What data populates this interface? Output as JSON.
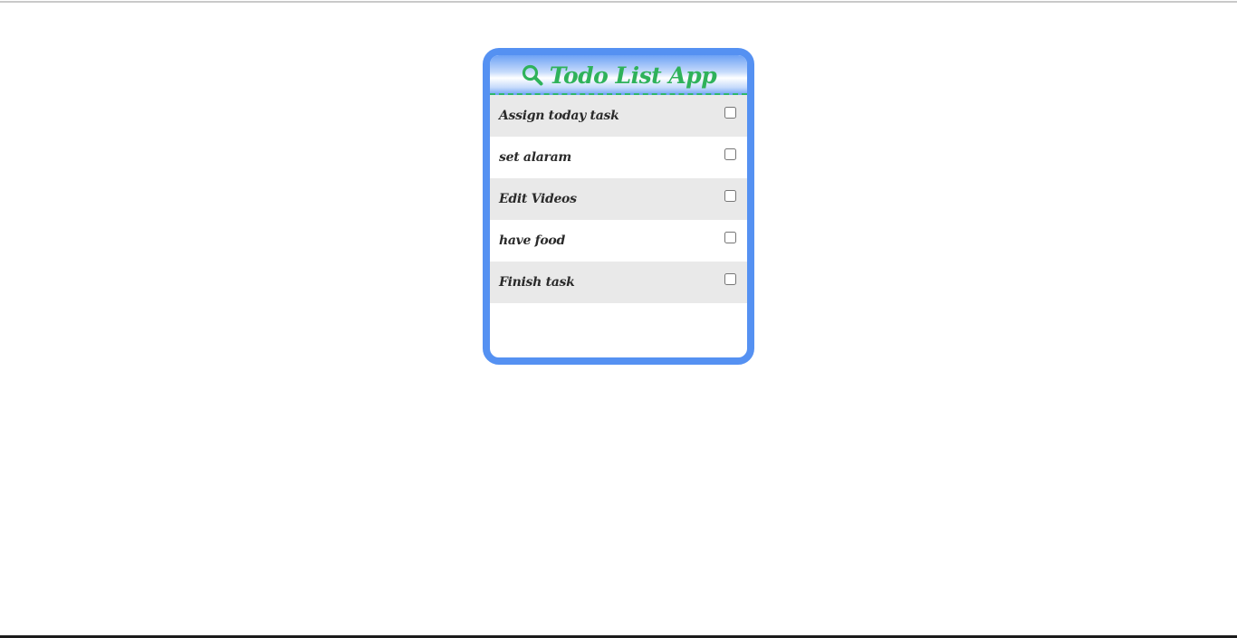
{
  "app": {
    "title": "Todo List App",
    "icon": "search-icon",
    "accent_color": "#5591f2",
    "title_color": "#2fb25a"
  },
  "tasks": [
    {
      "label": "Assign today task",
      "checked": false
    },
    {
      "label": "set alaram",
      "checked": false
    },
    {
      "label": "Edit Videos",
      "checked": false
    },
    {
      "label": "have food",
      "checked": false
    },
    {
      "label": "Finish task",
      "checked": false
    }
  ]
}
